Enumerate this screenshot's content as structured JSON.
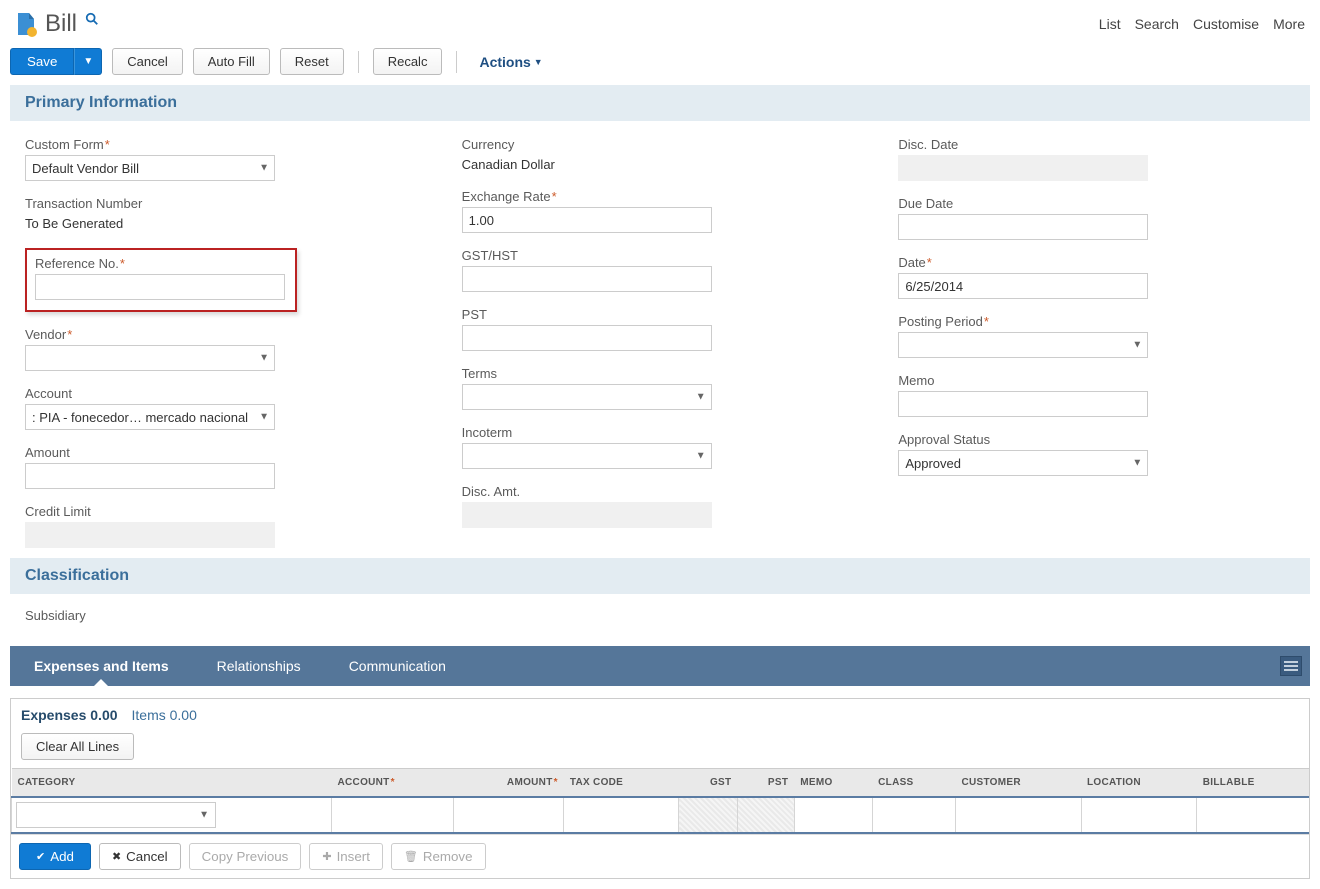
{
  "header": {
    "title": "Bill",
    "top_links": [
      "List",
      "Search",
      "Customise",
      "More"
    ]
  },
  "toolbar": {
    "save": "Save",
    "cancel": "Cancel",
    "autofill": "Auto Fill",
    "reset": "Reset",
    "recalc": "Recalc",
    "actions": "Actions"
  },
  "sections": {
    "primary": "Primary Information",
    "classification": "Classification"
  },
  "fields": {
    "custom_form": {
      "label": "Custom Form",
      "value": "Default Vendor Bill"
    },
    "tran_num": {
      "label": "Transaction Number",
      "value": "To Be Generated"
    },
    "ref_no": {
      "label": "Reference No.",
      "value": ""
    },
    "vendor": {
      "label": "Vendor",
      "value": ""
    },
    "account": {
      "label": "Account",
      "value": ": PIA - fonecedor… mercado nacional"
    },
    "amount": {
      "label": "Amount",
      "value": ""
    },
    "credit_limit": {
      "label": "Credit Limit"
    },
    "currency": {
      "label": "Currency",
      "value": "Canadian Dollar"
    },
    "exch_rate": {
      "label": "Exchange Rate",
      "value": "1.00"
    },
    "gsthst": {
      "label": "GST/HST",
      "value": ""
    },
    "pst": {
      "label": "PST",
      "value": ""
    },
    "terms": {
      "label": "Terms",
      "value": ""
    },
    "incoterm": {
      "label": "Incoterm",
      "value": ""
    },
    "disc_amt": {
      "label": "Disc. Amt."
    },
    "disc_date": {
      "label": "Disc. Date"
    },
    "due_date": {
      "label": "Due Date",
      "value": ""
    },
    "date": {
      "label": "Date",
      "value": "6/25/2014"
    },
    "posting_period": {
      "label": "Posting Period",
      "value": ""
    },
    "memo": {
      "label": "Memo",
      "value": ""
    },
    "approval": {
      "label": "Approval Status",
      "value": "Approved"
    },
    "subsidiary": {
      "label": "Subsidiary"
    }
  },
  "tabs": {
    "expenses_items": "Expenses and Items",
    "relationships": "Relationships",
    "communication": "Communication"
  },
  "subpanel": {
    "expenses_label": "Expenses 0.00",
    "items_label": "Items 0.00",
    "clear_all": "Clear All Lines",
    "columns": {
      "category": "CATEGORY",
      "account": "ACCOUNT",
      "amount": "AMOUNT",
      "taxcode": "TAX CODE",
      "gst": "GST",
      "pst": "PST",
      "memo": "MEMO",
      "class": "CLASS",
      "customer": "CUSTOMER",
      "location": "LOCATION",
      "billable": "BILLABLE"
    },
    "row_actions": {
      "add": "Add",
      "cancel": "Cancel",
      "copy_prev": "Copy Previous",
      "insert": "Insert",
      "remove": "Remove"
    }
  }
}
